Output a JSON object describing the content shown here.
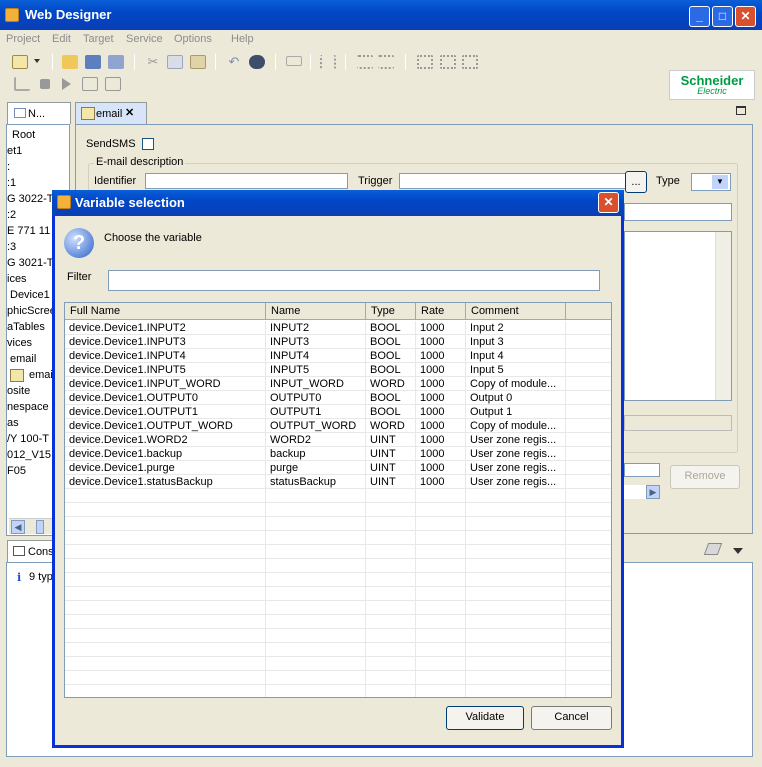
{
  "window": {
    "title": "Web Designer"
  },
  "menu": [
    "Project",
    "Edit",
    "Target",
    "Service",
    "Options",
    "Help"
  ],
  "logo": {
    "line1": "Schneider",
    "line2": "Electric"
  },
  "navigator": {
    "tab_label": "N...",
    "items": [
      "Root",
      "et1",
      ":",
      ":1",
      "G 3022-T",
      ":2",
      "E 771 11",
      ":3",
      "G 3021-T",
      "ices",
      "Device1",
      "phicScree",
      "aTables",
      "vices",
      "email",
      "emai",
      "osite",
      "nespace",
      "as",
      "/Y 100-T",
      "012_V15",
      "F05"
    ]
  },
  "editor": {
    "tab_label": "email",
    "sendsms_label": "SendSMS",
    "group_label": "E-mail description",
    "identifier_label": "Identifier",
    "trigger_label": "Trigger",
    "type_label": "Type",
    "browse_label": "...",
    "remove_label": "Remove"
  },
  "console": {
    "tab_label": "Cons",
    "message": "9 typ"
  },
  "dialog": {
    "title": "Variable selection",
    "prompt": "Choose the variable",
    "filter_label": "Filter",
    "filter_value": "",
    "columns": [
      "Full Name",
      "Name",
      "Type",
      "Rate",
      "Comment"
    ],
    "rows": [
      [
        "device.Device1.INPUT2",
        "INPUT2",
        "BOOL",
        "1000",
        "Input 2"
      ],
      [
        "device.Device1.INPUT3",
        "INPUT3",
        "BOOL",
        "1000",
        "Input 3"
      ],
      [
        "device.Device1.INPUT4",
        "INPUT4",
        "BOOL",
        "1000",
        "Input 4"
      ],
      [
        "device.Device1.INPUT5",
        "INPUT5",
        "BOOL",
        "1000",
        "Input 5"
      ],
      [
        "device.Device1.INPUT_WORD",
        "INPUT_WORD",
        "WORD",
        "1000",
        "Copy of module..."
      ],
      [
        "device.Device1.OUTPUT0",
        "OUTPUT0",
        "BOOL",
        "1000",
        "Output 0"
      ],
      [
        "device.Device1.OUTPUT1",
        "OUTPUT1",
        "BOOL",
        "1000",
        "Output 1"
      ],
      [
        "device.Device1.OUTPUT_WORD",
        "OUTPUT_WORD",
        "WORD",
        "1000",
        "Copy of module..."
      ],
      [
        "device.Device1.WORD2",
        "WORD2",
        "UINT",
        "1000",
        "User zone regis..."
      ],
      [
        "device.Device1.backup",
        "backup",
        "UINT",
        "1000",
        "User zone regis..."
      ],
      [
        "device.Device1.purge",
        "purge",
        "UINT",
        "1000",
        "User zone regis..."
      ],
      [
        "device.Device1.statusBackup",
        "statusBackup",
        "UINT",
        "1000",
        "User zone regis..."
      ]
    ],
    "validate_label": "Validate",
    "cancel_label": "Cancel"
  }
}
